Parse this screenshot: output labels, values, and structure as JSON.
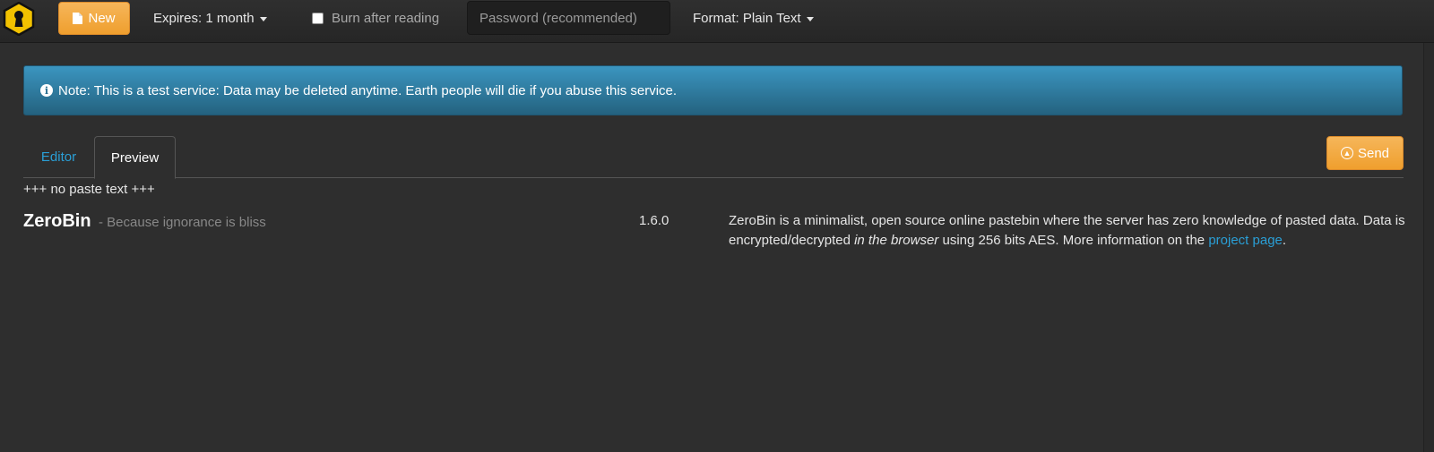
{
  "navbar": {
    "new_label": "New",
    "expires_label": "Expires: 1 month",
    "burn_label": "Burn after reading",
    "password_placeholder": "Password (recommended)",
    "format_label": "Format: Plain Text"
  },
  "note": {
    "text": "Note: This is a test service: Data may be deleted anytime. Earth people will die if you abuse this service."
  },
  "tabs": [
    {
      "label": "Editor",
      "active": false
    },
    {
      "label": "Preview",
      "active": true
    }
  ],
  "send_label": "Send",
  "content": {
    "placeholder_text": "+++ no paste text +++"
  },
  "footer": {
    "brand_name": "ZeroBin",
    "tagline": "- Because ignorance is bliss",
    "version": "1.6.0",
    "about_part1": "ZeroBin is a minimalist, open source online pastebin where the server has zero knowledge of pasted data. Data is encrypted/decrypted ",
    "about_emph": "in the browser",
    "about_part2": " using 256 bits AES. More information on the ",
    "about_link": "project page",
    "about_end": "."
  },
  "colors": {
    "accent_orange": "#ef9f2e",
    "link_blue": "#2a9fd6",
    "note_blue": "#2f7ea5",
    "background": "#2e2e2e"
  }
}
